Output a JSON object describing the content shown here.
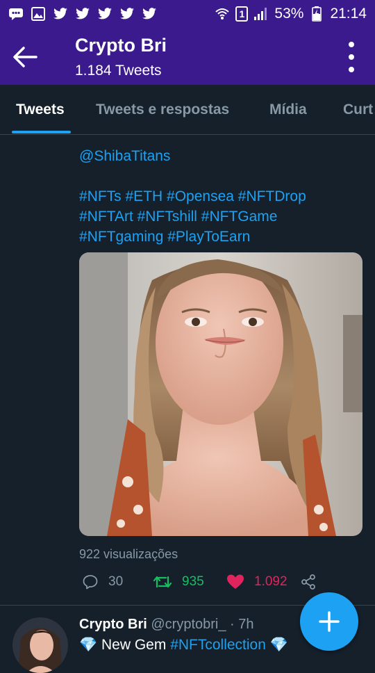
{
  "status_bar": {
    "battery": "53%",
    "time": "21:14",
    "sim": "1",
    "left_icons": [
      "message-icon",
      "gallery-icon",
      "twitter-icon",
      "twitter-icon",
      "twitter-icon",
      "twitter-icon",
      "twitter-icon"
    ]
  },
  "header": {
    "title": "Crypto Bri",
    "subtitle": "1.184 Tweets"
  },
  "tabs": [
    {
      "label": "Tweets",
      "active": true
    },
    {
      "label": "Tweets e respostas",
      "active": false
    },
    {
      "label": "Mídia",
      "active": false
    },
    {
      "label": "Curt",
      "active": false
    }
  ],
  "tweet": {
    "mention": "@ShibaTitans",
    "hashtag_lines": [
      "#NFTs #ETH #Opensea #NFTDrop",
      "#NFTArt #NFTshill #NFTGame",
      "#NFTgaming #PlayToEarn"
    ],
    "views": "922 visualizações",
    "replies": "30",
    "retweets": "935",
    "likes": "1.092"
  },
  "next_tweet": {
    "name": "Crypto Bri",
    "handle": "@cryptobri_",
    "time": "· 7h",
    "text_before": " New Gem ",
    "hashtag": "#NFTcollection"
  },
  "colors": {
    "header_bg": "#3a1a8c",
    "page_bg": "#15202b",
    "accent": "#1da1f2",
    "retweet": "#17bf63",
    "like": "#e0245e"
  }
}
